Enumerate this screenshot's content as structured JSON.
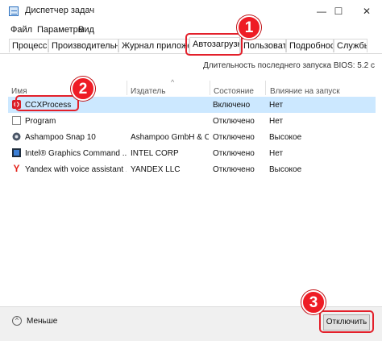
{
  "window": {
    "title": "Диспетчер задач",
    "buttons": {
      "minimize": "—",
      "maximize": "☐",
      "close": "✕"
    }
  },
  "menu": [
    "Файл",
    "Параметры",
    "Вид"
  ],
  "tabs": [
    {
      "label": "Процессы",
      "active": false
    },
    {
      "label": "Производительность",
      "active": false
    },
    {
      "label": "Журнал приложений",
      "active": false
    },
    {
      "label": "Автозагрузка",
      "active": true
    },
    {
      "label": "Пользователи",
      "active": false
    },
    {
      "label": "Подробности",
      "active": false
    },
    {
      "label": "Службы",
      "active": false
    }
  ],
  "bios_text": "Длительность последнего запуска BIOS: 5.2 с",
  "columns": {
    "name": "Имя",
    "publisher": "Издатель",
    "state": "Состояние",
    "impact": "Влияние на запуск"
  },
  "rows": [
    {
      "name": "CCXProcess",
      "publisher": "",
      "state": "Включено",
      "impact": "Нет",
      "icon": "ccx-process-icon",
      "selected": true
    },
    {
      "name": "Program",
      "publisher": "",
      "state": "Отключено",
      "impact": "Нет",
      "icon": "program-icon",
      "selected": false
    },
    {
      "name": "Ashampoo Snap 10",
      "publisher": "Ashampoo GmbH & Co...",
      "state": "Отключено",
      "impact": "Высокое",
      "icon": "ashampoo-icon",
      "selected": false
    },
    {
      "name": "Intel® Graphics Command ...",
      "publisher": "INTEL CORP",
      "state": "Отключено",
      "impact": "Нет",
      "icon": "intel-icon",
      "selected": false
    },
    {
      "name": "Yandex with voice assistant ...",
      "publisher": "YANDEX LLC",
      "state": "Отключено",
      "impact": "Высокое",
      "icon": "yandex-icon",
      "selected": false
    }
  ],
  "footer": {
    "less_label": "Меньше",
    "disable_label": "Отключить"
  },
  "annotations": {
    "step1": "1",
    "step2": "2",
    "step3": "3"
  },
  "colors": {
    "accent_red": "#e3202b",
    "selection": "#cce8ff"
  }
}
